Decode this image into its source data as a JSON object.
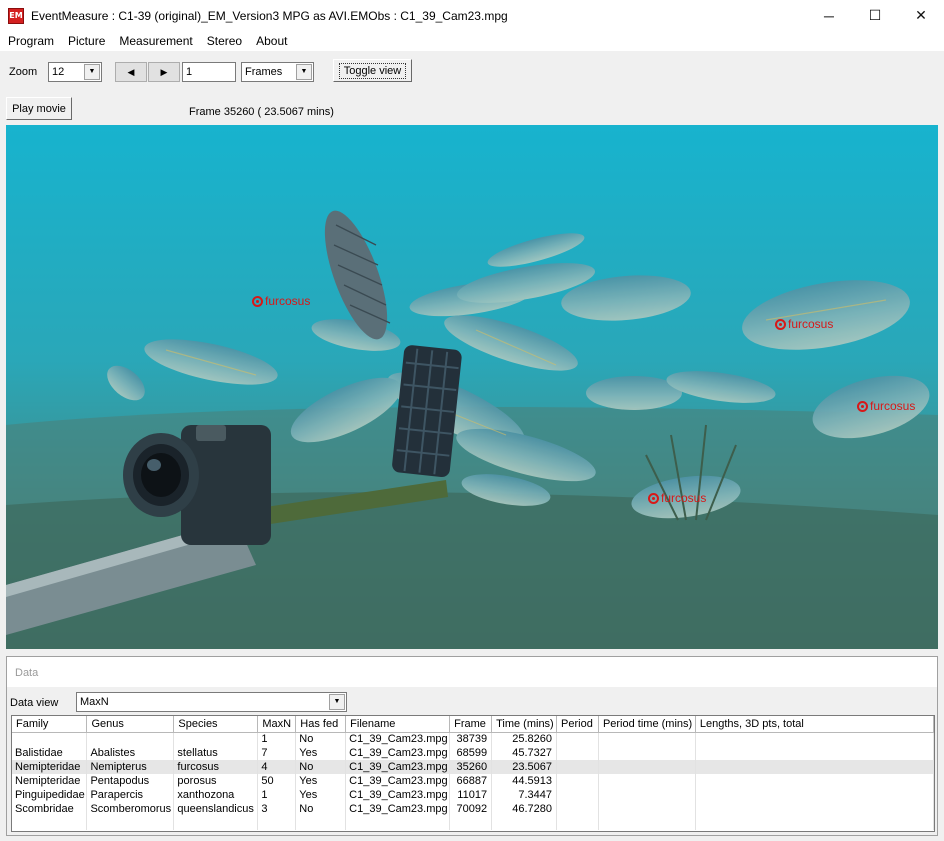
{
  "window": {
    "icon_text": "EM",
    "title": "EventMeasure : C1-39 (original)_EM_Version3 MPG as AVI.EMObs : C1_39_Cam23.mpg",
    "minimize": "─",
    "maximize": "☐",
    "close": "✕"
  },
  "menu": [
    "Program",
    "Picture",
    "Measurement",
    "Stereo",
    "About"
  ],
  "toolbar": {
    "zoom_label": "Zoom",
    "zoom_value": "12",
    "prev_icon": "◀",
    "next_icon": "▶",
    "step_value": "1",
    "unit_value": "Frames",
    "toggle_view": "Toggle view",
    "play_movie": "Play movie",
    "frame_info": "Frame 35260 (  23.5067 mins)"
  },
  "video": {
    "tags": [
      "furcosus",
      "furcosus",
      "furcosus",
      "furcosus"
    ]
  },
  "data": {
    "title": "Data",
    "view_label": "Data view",
    "view_value": "MaxN",
    "columns": [
      "Family",
      "Genus",
      "Species",
      "MaxN",
      "Has fed",
      "Filename",
      "Frame",
      "Time (mins)",
      "Period",
      "Period time (mins)",
      "Lengths, 3D pts, total"
    ],
    "rows": [
      [
        "",
        "",
        "",
        "1",
        "No",
        "C1_39_Cam23.mpg",
        "38739",
        "25.8260",
        "",
        "",
        ""
      ],
      [
        "Balistidae",
        "Abalistes",
        "stellatus",
        "7",
        "Yes",
        "C1_39_Cam23.mpg",
        "68599",
        "45.7327",
        "",
        "",
        ""
      ],
      [
        "Nemipteridae",
        "Nemipterus",
        "furcosus",
        "4",
        "No",
        "C1_39_Cam23.mpg",
        "35260",
        "23.5067",
        "",
        "",
        ""
      ],
      [
        "Nemipteridae",
        "Pentapodus",
        "porosus",
        "50",
        "Yes",
        "C1_39_Cam23.mpg",
        "66887",
        "44.5913",
        "",
        "",
        ""
      ],
      [
        "Pinguipedidae",
        "Parapercis",
        "xanthozona",
        "1",
        "Yes",
        "C1_39_Cam23.mpg",
        "11017",
        "7.3447",
        "",
        "",
        ""
      ],
      [
        "Scombridae",
        "Scomberomorus",
        "queenslandicus",
        "3",
        "No",
        "C1_39_Cam23.mpg",
        "70092",
        "46.7280",
        "",
        "",
        ""
      ]
    ],
    "selected_row": 2
  }
}
